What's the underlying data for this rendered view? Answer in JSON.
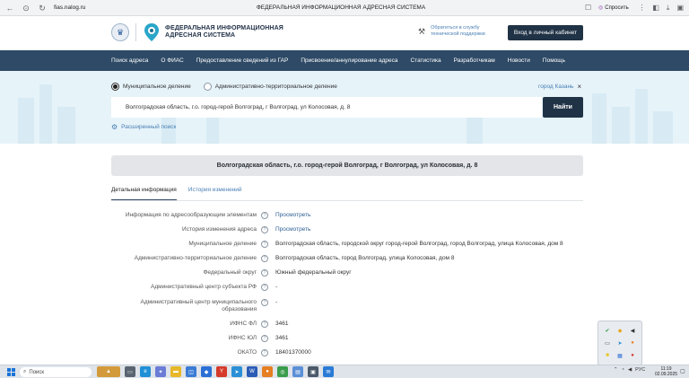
{
  "browser": {
    "url": "fias.nalog.ru",
    "page_title": "ФЕДЕРАЛЬНАЯ ИНФОРМАЦИОННАЯ АДРЕСНАЯ СИСТЕМА",
    "ask_label": "Спросить"
  },
  "header": {
    "logo_line1": "ФЕДЕРАЛЬНАЯ ИНФОРМАЦИОННАЯ",
    "logo_line2": "АДРЕСНАЯ СИСТЕМА",
    "support_line1": "Обратиться в службу",
    "support_line2": "технической поддержки",
    "cabinet_button": "Вход в личный кабинет"
  },
  "nav": {
    "items": [
      "Поиск адреса",
      "О ФИАС",
      "Предоставление сведений из ГАР",
      "Присвоение/аннулирование адреса",
      "Статистика",
      "Разработчикам",
      "Новости",
      "Помощь"
    ]
  },
  "search": {
    "mode_municipal": "Муниципальное деление",
    "mode_admin": "Административно-территориальное деление",
    "city_label": "город Казань",
    "query": "Волгоградская область, г.о. город-герой Волгоград, г Волгоград, ул Колосовая, д. 8",
    "find_button": "Найти",
    "advanced_search": "Расширенный поиск"
  },
  "result": {
    "title": "Волгоградская область, г.о. город-герой Волгоград, г Волгоград, ул Колосовая, д. 8",
    "tab_details": "Детальная информация",
    "tab_history": "История изменений",
    "rows": [
      {
        "label": "Информация по адресообразующим элементам",
        "value": "Просмотреть",
        "link": true
      },
      {
        "label": "История изменения адреса",
        "value": "Просмотреть",
        "link": true
      },
      {
        "label": "Муниципальное деление",
        "value": "Волгоградская область, городской округ город-герой Волгоград, город Волгоград, улица Колосовая, дом 8",
        "link": false
      },
      {
        "label": "Административно-территориальное деление",
        "value": "Волгоградская область, город Волгоград, улица Колосовая, дом 8",
        "link": false
      },
      {
        "label": "Федеральный округ",
        "value": "Южный федеральный округ",
        "link": false
      },
      {
        "label": "Административный центр субъекта РФ",
        "value": "-",
        "link": false
      },
      {
        "label": "Административный центр муниципального образования",
        "value": "-",
        "link": false
      },
      {
        "label": "ИФНС ФЛ",
        "value": "3461",
        "link": false
      },
      {
        "label": "ИФНС ЮЛ",
        "value": "3461",
        "link": false
      },
      {
        "label": "ОКАТО",
        "value": "18401370000",
        "link": false
      }
    ]
  },
  "taskbar": {
    "search_label": "Поиск",
    "lang": "РУС",
    "time": "11:19",
    "date": "02.09.2025"
  },
  "colors": {
    "nav_bg": "#2e4a66",
    "button_bg": "#203346",
    "link": "#4a7fb4",
    "hero_bg": "#e6f3f9"
  }
}
